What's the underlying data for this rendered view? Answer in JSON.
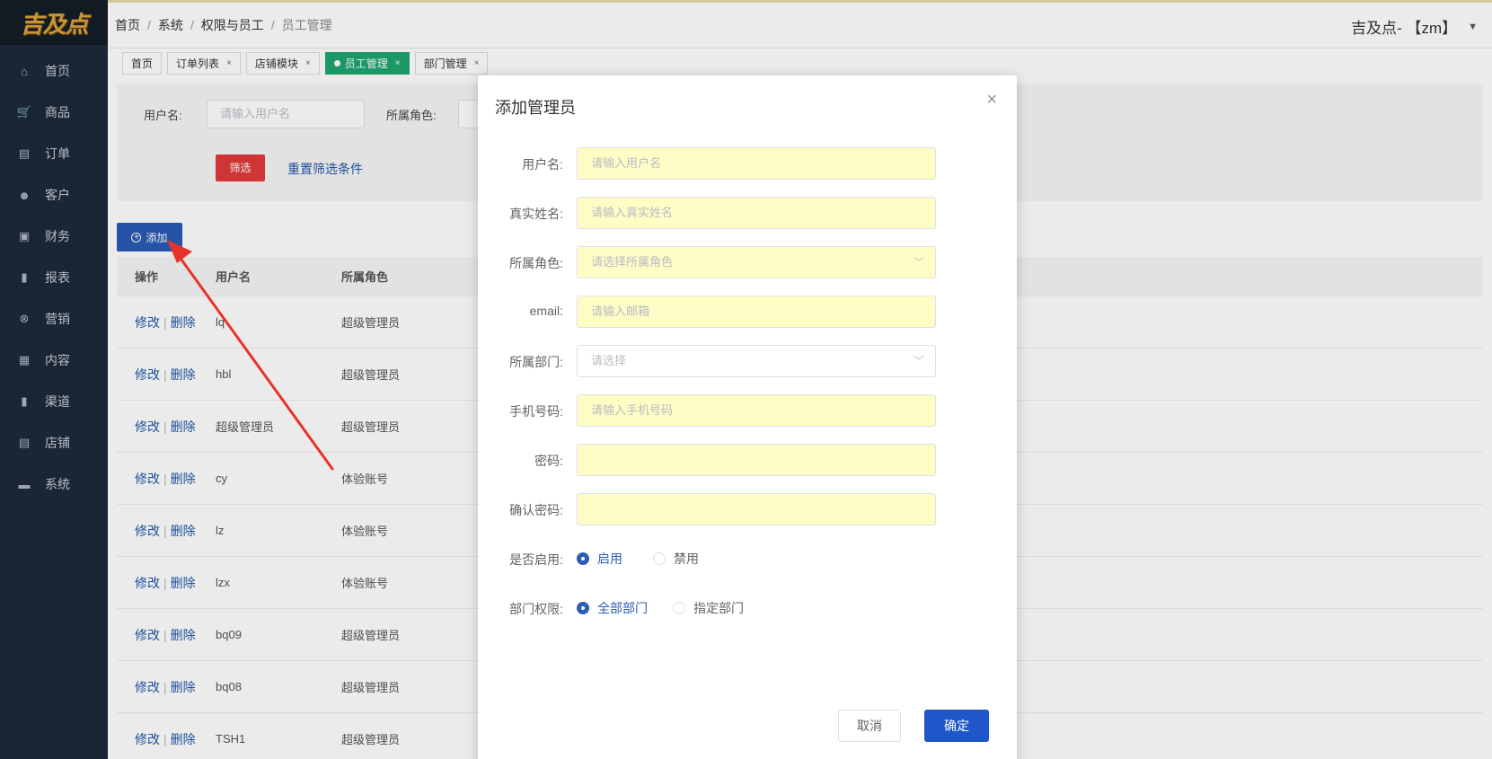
{
  "logo": {
    "text": "吉及点"
  },
  "sidebar": {
    "items": [
      {
        "label": "首页",
        "icon": "home-icon",
        "glyph": "⌂"
      },
      {
        "label": "商品",
        "icon": "cart-icon",
        "glyph": "🛒"
      },
      {
        "label": "订单",
        "icon": "order-icon",
        "glyph": "▤"
      },
      {
        "label": "客户",
        "icon": "user-icon",
        "glyph": "☻"
      },
      {
        "label": "财务",
        "icon": "finance-icon",
        "glyph": "▣"
      },
      {
        "label": "报表",
        "icon": "chart-icon",
        "glyph": "▮"
      },
      {
        "label": "营销",
        "icon": "marketing-icon",
        "glyph": "⊗"
      },
      {
        "label": "内容",
        "icon": "content-icon",
        "glyph": "▦"
      },
      {
        "label": "渠道",
        "icon": "channel-icon",
        "glyph": "▮"
      },
      {
        "label": "店铺",
        "icon": "shop-icon",
        "glyph": "▤"
      },
      {
        "label": "系统",
        "icon": "system-icon",
        "glyph": "▬"
      }
    ]
  },
  "header": {
    "breadcrumb": [
      "首页",
      "系统",
      "权限与员工",
      "员工管理"
    ],
    "user": "吉及点- 【zm】"
  },
  "tabs": [
    {
      "label": "首页",
      "closable": false,
      "active": false
    },
    {
      "label": "订单列表",
      "closable": true,
      "active": false
    },
    {
      "label": "店铺模块",
      "closable": true,
      "active": false
    },
    {
      "label": "员工管理",
      "closable": true,
      "active": true
    },
    {
      "label": "部门管理",
      "closable": true,
      "active": false
    }
  ],
  "filter": {
    "username_label": "用户名:",
    "username_placeholder": "请输入用户名",
    "role_label": "所属角色:",
    "filter_button": "筛选",
    "reset_link": "重置筛选条件"
  },
  "add_button": "添加",
  "table": {
    "headers": [
      "操作",
      "用户名",
      "所属角色"
    ],
    "edit": "修改",
    "delete": "删除",
    "rows": [
      {
        "username": "lq",
        "role": "超级管理员"
      },
      {
        "username": "hbl",
        "role": "超级管理员"
      },
      {
        "username": "超级管理员",
        "role": "超级管理员"
      },
      {
        "username": "cy",
        "role": "体验账号"
      },
      {
        "username": "lz",
        "role": "体验账号"
      },
      {
        "username": "lzx",
        "role": "体验账号"
      },
      {
        "username": "bq09",
        "role": "超级管理员"
      },
      {
        "username": "bq08",
        "role": "超级管理员"
      },
      {
        "username": "TSH1",
        "role": "超级管理员"
      }
    ]
  },
  "modal": {
    "title": "添加管理员",
    "fields": {
      "username": {
        "label": "用户名:",
        "placeholder": "请输入用户名"
      },
      "realname": {
        "label": "真实姓名:",
        "placeholder": "请输入真实姓名"
      },
      "role": {
        "label": "所属角色:",
        "placeholder": "请选择所属角色"
      },
      "email": {
        "label": "email:",
        "placeholder": "请输入邮箱"
      },
      "dept": {
        "label": "所属部门:",
        "placeholder": "请选择"
      },
      "phone": {
        "label": "手机号码:",
        "placeholder": "请输入手机号码"
      },
      "password": {
        "label": "密码:",
        "placeholder": ""
      },
      "confirm": {
        "label": "确认密码:",
        "placeholder": ""
      }
    },
    "enabled": {
      "label": "是否启用:",
      "options": [
        "启用",
        "禁用"
      ],
      "selected": "启用"
    },
    "dept_perm": {
      "label": "部门权限:",
      "options": [
        "全部部门",
        "指定部门"
      ],
      "selected": "全部部门"
    },
    "cancel": "取消",
    "confirm_button": "确定"
  },
  "colors": {
    "sidebar_bg": "#1d2a3a",
    "active_tab": "#1fa56f",
    "primary": "#1f56c9",
    "danger": "#e23a3a",
    "input_autofill": "#fffdc6",
    "annotation_arrow": "#e8332a"
  }
}
